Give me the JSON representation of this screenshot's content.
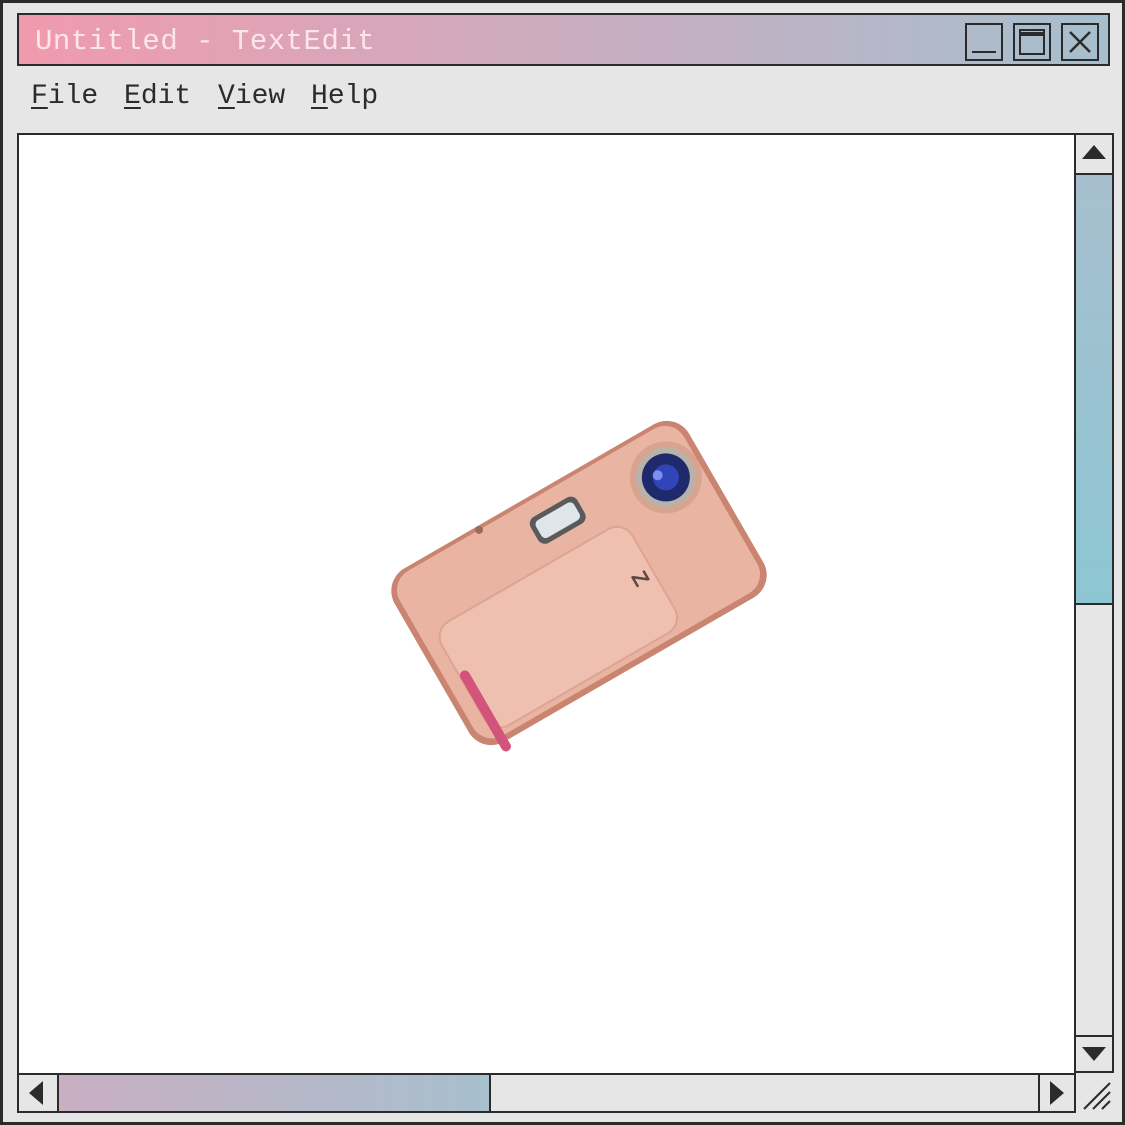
{
  "window": {
    "title": "Untitled - TextEdit",
    "colors": {
      "titlebar_gradient": [
        "#f19aae",
        "#c7aec1",
        "#a6bfce"
      ],
      "title_text": "#fde6ea",
      "chrome": "#e6e6e6",
      "border": "#2b2b2b",
      "scroll_thumb_vertical": [
        "#a7bfce",
        "#8dc6d3"
      ],
      "scroll_thumb_horizontal": [
        "#c9afc2",
        "#a7bfce"
      ]
    },
    "controls": {
      "minimize_icon": "minimize-icon",
      "maximize_icon": "maximize-icon",
      "close_icon": "close-icon"
    }
  },
  "menu": {
    "items": [
      {
        "accel": "F",
        "rest": "ile"
      },
      {
        "accel": "E",
        "rest": "dit"
      },
      {
        "accel": "V",
        "rest": "iew"
      },
      {
        "accel": "H",
        "rest": "elp"
      }
    ]
  },
  "document": {
    "image": {
      "subject": "pink compact digital camera",
      "colors": {
        "body": "#eab4a3",
        "edge": "#c98570",
        "lens": "#1e2a6b",
        "grip_stripe": "#d4537a"
      }
    }
  },
  "scrollbars": {
    "vertical": {
      "up_icon": "arrow-up-icon",
      "down_icon": "arrow-down-icon",
      "thumb_start": 0.0,
      "thumb_fraction": 0.48
    },
    "horizontal": {
      "left_icon": "arrow-left-icon",
      "right_icon": "arrow-right-icon",
      "thumb_start": 0.0,
      "thumb_fraction": 0.44
    }
  },
  "resize_grip_icon": "resize-grip-icon"
}
